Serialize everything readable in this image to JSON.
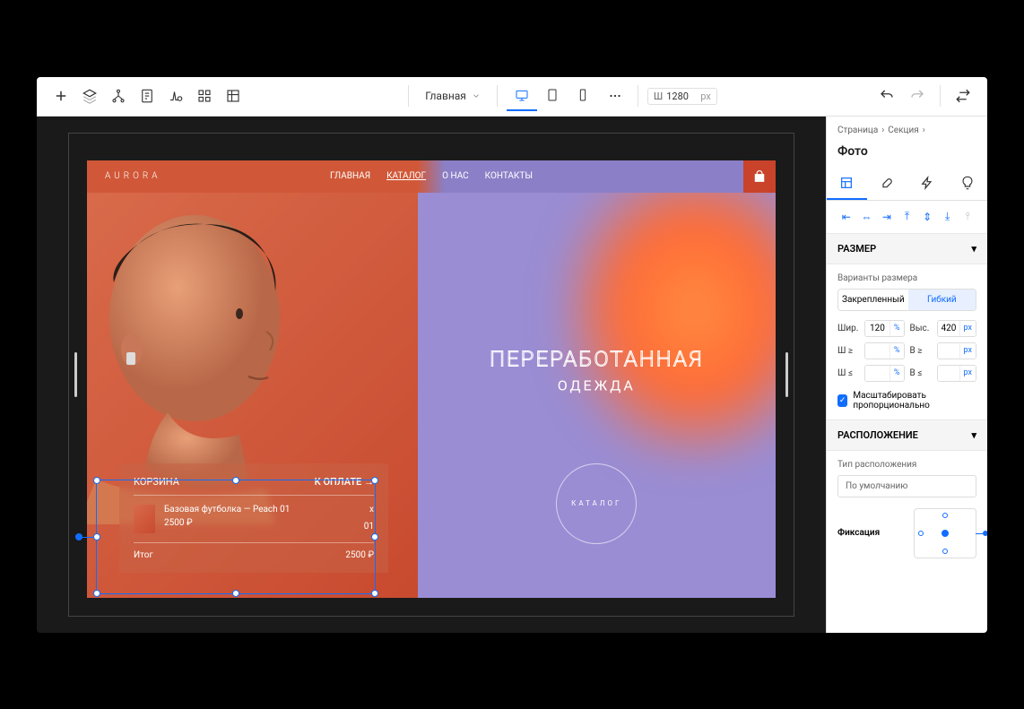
{
  "toolbar": {
    "page_dropdown": "Главная",
    "width_label": "Ш",
    "width_value": "1280",
    "width_unit": "px"
  },
  "breadcrumb": {
    "page": "Страница",
    "section": "Секция"
  },
  "inspector": {
    "title": "Фото",
    "size_section": "РАЗМЕР",
    "size_variants_label": "Варианты размера",
    "fixed": "Закрепленный",
    "flex": "Гибкий",
    "width_label": "Шир.",
    "width_val": "120",
    "width_unit": "%",
    "height_label": "Выс.",
    "height_val": "420",
    "height_unit": "px",
    "wmin_label": "Ш ≥",
    "wmin_unit": "%",
    "hmin_label": "В ≥",
    "hmin_unit": "px",
    "wmax_label": "Ш ≤",
    "wmax_unit": "%",
    "hmax_label": "В ≤",
    "hmax_unit": "px",
    "scale_prop": "Масштабировать пропорционально",
    "position_section": "РАСПОЛОЖЕНИЕ",
    "position_type_label": "Тип расположения",
    "position_type_value": "По умолчанию",
    "dock_label": "Фиксация"
  },
  "site": {
    "logo": "AURORA",
    "nav": {
      "home": "ГЛАВНАЯ",
      "catalog": "КАТАЛОГ",
      "about": "О НАС",
      "contacts": "КОНТАКТЫ"
    },
    "hero_h1": "ПЕРЕРАБОТАННАЯ",
    "hero_h2": "ОДЕЖДА",
    "catalog_btn": "КАТАЛОГ",
    "cart": {
      "title": "КОРЗИНА",
      "checkout": "К ОПЛАТЕ →",
      "item_name": "Базовая футболка — Peach 01",
      "item_price": "2500 ₽",
      "item_remove": "x",
      "item_qty": "01",
      "total_label": "Итог",
      "total_value": "2500 ₽"
    }
  }
}
